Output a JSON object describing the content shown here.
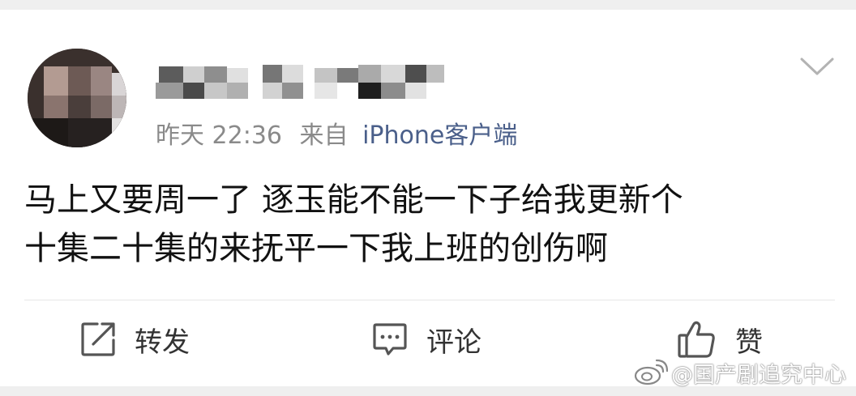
{
  "post": {
    "avatar_icon": "blurred-avatar-icon",
    "username_icon": "pixelated-username-icon",
    "time": "昨天 22:36",
    "source_prefix": "来自",
    "source": "iPhone客户端",
    "content_lines": [
      "马上又要周一了 逐玉能不能一下子给我更新个",
      "十集二十集的来抚平一下我上班的创伤啊"
    ]
  },
  "actions": {
    "repost": {
      "icon": "share-icon",
      "label": "转发"
    },
    "comment": {
      "icon": "comment-icon",
      "label": "评论"
    },
    "like": {
      "icon": "thumbs-up-icon",
      "label": "赞"
    }
  },
  "watermark": {
    "icon": "weibo-logo-icon",
    "text": "@国产剧追究中心"
  },
  "colors": {
    "page_background": "#efefef",
    "card_background": "#ffffff",
    "meta_text": "#8a8a8a",
    "source_link": "#4a5f8a",
    "content_text": "#111111"
  }
}
